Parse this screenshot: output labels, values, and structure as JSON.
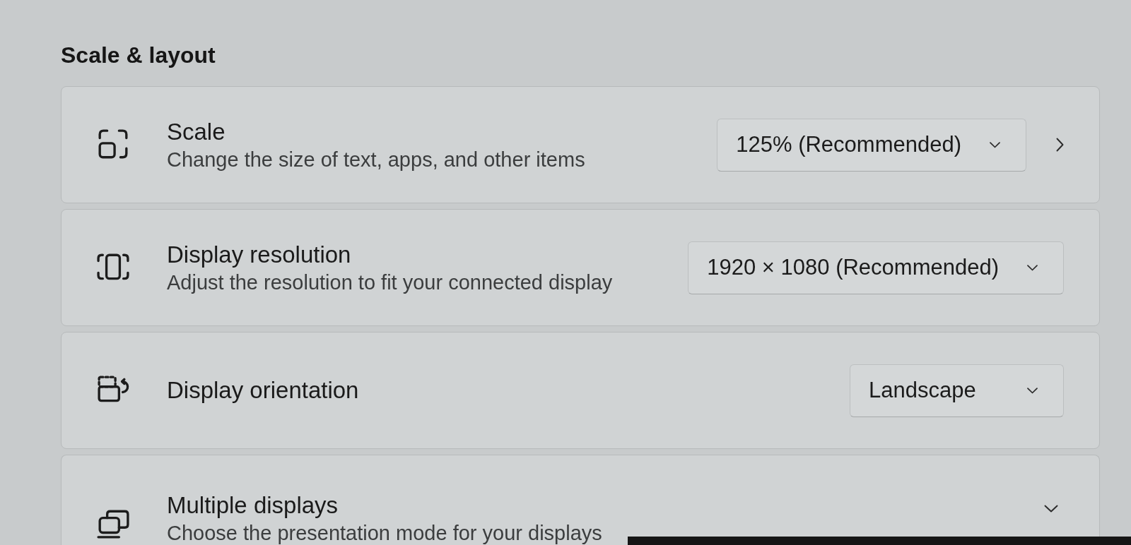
{
  "section": {
    "title": "Scale & layout"
  },
  "settings": [
    {
      "kind": "dropdown_link",
      "title": "Scale",
      "description": "Change the size of text, apps, and other items",
      "value": "125% (Recommended)"
    },
    {
      "kind": "dropdown",
      "title": "Display resolution",
      "description": "Adjust the resolution to fit your connected display",
      "value": "1920 × 1080 (Recommended)"
    },
    {
      "kind": "dropdown",
      "title": "Display orientation",
      "value": "Landscape"
    },
    {
      "kind": "expander",
      "title": "Multiple displays",
      "description": "Choose the presentation mode for your displays",
      "expanded": false
    }
  ]
}
